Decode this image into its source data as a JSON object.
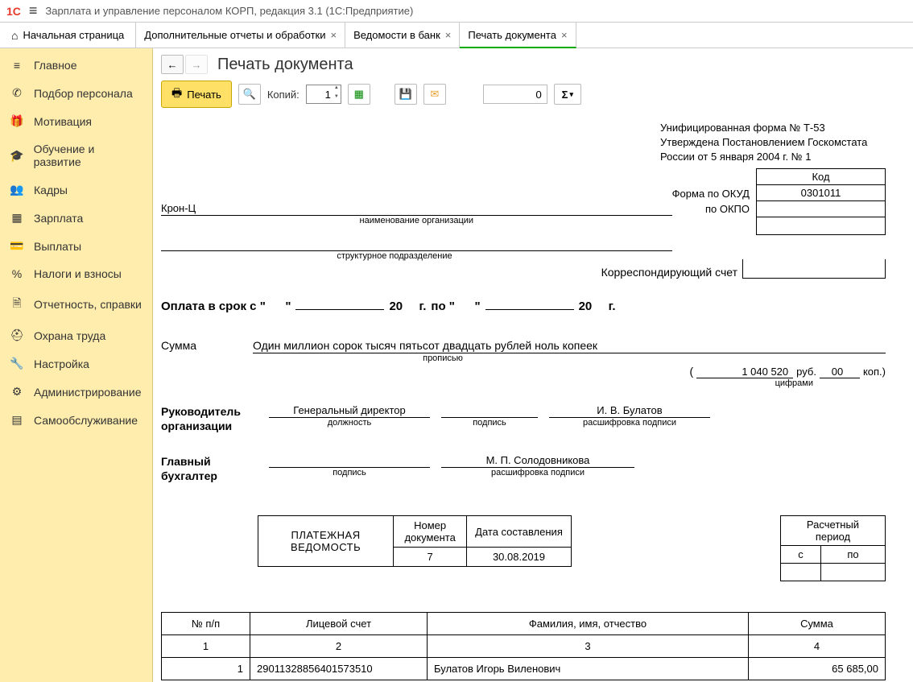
{
  "app": {
    "title": "Зарплата и управление персоналом КОРП, редакция 3.1  (1С:Предприятие)"
  },
  "tabs": {
    "home": "Начальная страница",
    "items": [
      {
        "label": "Дополнительные отчеты и обработки",
        "active": false
      },
      {
        "label": "Ведомости в банк",
        "active": false
      },
      {
        "label": "Печать документа",
        "active": true
      }
    ]
  },
  "sidebar": {
    "items": [
      {
        "icon": "≡",
        "label": "Главное"
      },
      {
        "icon": "✆",
        "label": "Подбор персонала"
      },
      {
        "icon": "🎁",
        "label": "Мотивация"
      },
      {
        "icon": "🎓",
        "label": "Обучение и развитие"
      },
      {
        "icon": "👥",
        "label": "Кадры"
      },
      {
        "icon": "▦",
        "label": "Зарплата"
      },
      {
        "icon": "💳",
        "label": "Выплаты"
      },
      {
        "icon": "%",
        "label": "Налоги и взносы"
      },
      {
        "icon": "🗎",
        "label": "Отчетность, справки"
      },
      {
        "icon": "⛑",
        "label": "Охрана труда"
      },
      {
        "icon": "🔧",
        "label": "Настройка"
      },
      {
        "icon": "⚙",
        "label": "Администрирование"
      },
      {
        "icon": "▤",
        "label": "Самообслуживание"
      }
    ]
  },
  "page": {
    "title": "Печать документа",
    "toolbar": {
      "print": "Печать",
      "copies_label": "Копий:",
      "copies": "1",
      "zero": "0"
    }
  },
  "doc": {
    "form_label": "Унифицированная форма № Т-53",
    "approved1": "Утверждена Постановлением Госкомстата",
    "approved2": "России от 5 января 2004 г. № 1",
    "code_header": "Код",
    "okud_label": "Форма по ОКУД",
    "okud": "0301011",
    "okpo_label": "по ОКПО",
    "org_name": "Крон-Ц",
    "org_caption": "наименование организации",
    "subdiv_caption": "структурное подразделение",
    "korr_label": "Корреспондирующий счет",
    "payment_prefix": "Оплата в срок с  \"",
    "payment_q": "\"",
    "payment_20": "20",
    "payment_g": "г.",
    "payment_po": "по \"",
    "sum_label": "Сумма",
    "sum_text": "Один миллион сорок тысяч пятьсот двадцать рублей ноль копеек",
    "sum_text_caption": "прописью",
    "sum_paren_open": "(",
    "sum_digits": "1 040 520",
    "sum_rub": "руб.",
    "sum_kop_digits": "00",
    "sum_kop": "коп.)",
    "sum_digits_caption": "цифрами",
    "head_label": "Руководитель организации",
    "head_position": "Генеральный директор",
    "position_caption": "должность",
    "sign_caption": "подпись",
    "decode_caption": "расшифровка подписи",
    "head_name": "И. В. Булатов",
    "acc_label": "Главный бухгалтер",
    "acc_name": "М. П. Солодовникова",
    "pv_title1": "ПЛАТЕЖНАЯ",
    "pv_title2": "ВЕДОМОСТЬ",
    "pv_num_label": "Номер документа",
    "pv_num": "7",
    "pv_date_label": "Дата составления",
    "pv_date": "30.08.2019",
    "period_label": "Расчетный период",
    "period_from": "с",
    "period_to": "по",
    "table": {
      "h1": "№ п/п",
      "h2": "Лицевой счет",
      "h3": "Фамилия, имя, отчество",
      "h4": "Сумма",
      "n1": "1",
      "n2": "2",
      "n3": "3",
      "n4": "4",
      "rows": [
        {
          "n": "1",
          "acc": "29011328856401573510",
          "fio": "Булатов Игорь Виленович",
          "sum": "65 685,00"
        }
      ]
    }
  }
}
